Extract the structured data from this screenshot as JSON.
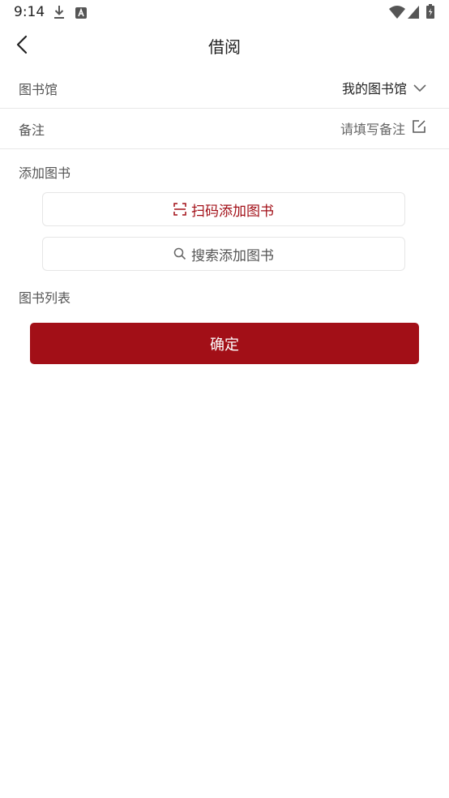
{
  "status_bar": {
    "time": "9:14",
    "icons": [
      "download-icon",
      "a-notification-icon",
      "wifi-icon",
      "signal-icon",
      "battery-icon"
    ]
  },
  "header": {
    "title": "借阅",
    "back_icon": "chevron-left-icon"
  },
  "library_row": {
    "label": "图书馆",
    "value": "我的图书馆",
    "icon": "chevron-down-icon"
  },
  "note_row": {
    "label": "备注",
    "placeholder": "请填写备注",
    "icon": "edit-icon"
  },
  "add_books": {
    "label": "添加图书",
    "scan_button": "扫码添加图书",
    "scan_icon": "scan-icon",
    "search_button": "搜索添加图书",
    "search_icon": "search-icon"
  },
  "book_list": {
    "label": "图书列表"
  },
  "confirm_button": "确定",
  "colors": {
    "accent": "#a20f17",
    "text_muted": "#555555",
    "divider": "#e8e8e8"
  }
}
